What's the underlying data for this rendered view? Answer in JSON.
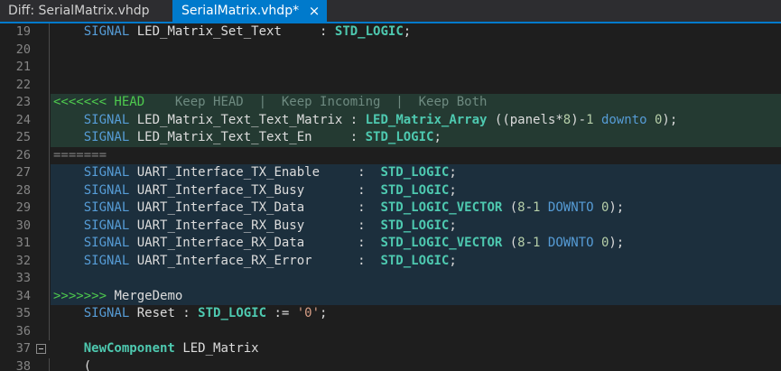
{
  "tabs": [
    {
      "label": "Diff: SerialMatrix.vhdp"
    },
    {
      "label": "SerialMatrix.vhdp*",
      "close": "×"
    }
  ],
  "editor": {
    "l19": {
      "num": "19",
      "kw": "SIGNAL",
      "name": "LED_Matrix_Set_Text     : ",
      "type": "STD_LOGIC",
      "end": ";"
    },
    "l20": {
      "num": "20"
    },
    "l21": {
      "num": "21"
    },
    "l22": {
      "num": "22"
    },
    "l23": {
      "num": "23",
      "marker": "<<<<<<< HEAD",
      "actions": "    Keep HEAD  |  Keep Incoming  |  Keep Both"
    },
    "l24": {
      "num": "24",
      "kw": "SIGNAL",
      "name": "LED_Matrix_Text_Text_Matrix : ",
      "type": "LED_Matrix_Array",
      "p1": " ((panels*",
      "n1": "8",
      "p2": ")-",
      "n2": "1",
      "kw2": "downto",
      "n3": "0",
      "end": ");"
    },
    "l25": {
      "num": "25",
      "kw": "SIGNAL",
      "name": "LED_Matrix_Text_Text_En     : ",
      "type": "STD_LOGIC",
      "end": ";"
    },
    "l26": {
      "num": "26",
      "sep": "======="
    },
    "l27": {
      "num": "27",
      "kw": "SIGNAL",
      "name": "UART_Interface_TX_Enable     :  ",
      "type": "STD_LOGIC",
      "end": ";"
    },
    "l28": {
      "num": "28",
      "kw": "SIGNAL",
      "name": "UART_Interface_TX_Busy       :  ",
      "type": "STD_LOGIC",
      "end": ";"
    },
    "l29": {
      "num": "29",
      "kw": "SIGNAL",
      "name": "UART_Interface_TX_Data       :  ",
      "type": "STD_LOGIC_VECTOR",
      "p1": " (",
      "n1": "8",
      "p2": "-",
      "n2": "1",
      "kw2": "DOWNTO",
      "n3": "0",
      "end": ");"
    },
    "l30": {
      "num": "30",
      "kw": "SIGNAL",
      "name": "UART_Interface_RX_Busy       :  ",
      "type": "STD_LOGIC",
      "end": ";"
    },
    "l31": {
      "num": "31",
      "kw": "SIGNAL",
      "name": "UART_Interface_RX_Data       :  ",
      "type": "STD_LOGIC_VECTOR",
      "p1": " (",
      "n1": "8",
      "p2": "-",
      "n2": "1",
      "kw2": "DOWNTO",
      "n3": "0",
      "end": ");"
    },
    "l32": {
      "num": "32",
      "kw": "SIGNAL",
      "name": "UART_Interface_RX_Error      :  ",
      "type": "STD_LOGIC",
      "end": ";"
    },
    "l33": {
      "num": "33"
    },
    "l34": {
      "num": "34",
      "marker": ">>>>>>> ",
      "label": "MergeDemo"
    },
    "l35": {
      "num": "35",
      "kw": "SIGNAL",
      "name": "Reset : ",
      "type": "STD_LOGIC",
      "p1": " := ",
      "str": "'0'",
      "end": ";"
    },
    "l36": {
      "num": "36"
    },
    "l37": {
      "num": "37",
      "kw": "NewComponent",
      "name": "LED_Matrix"
    },
    "l38": {
      "num": "38",
      "text": "("
    }
  }
}
